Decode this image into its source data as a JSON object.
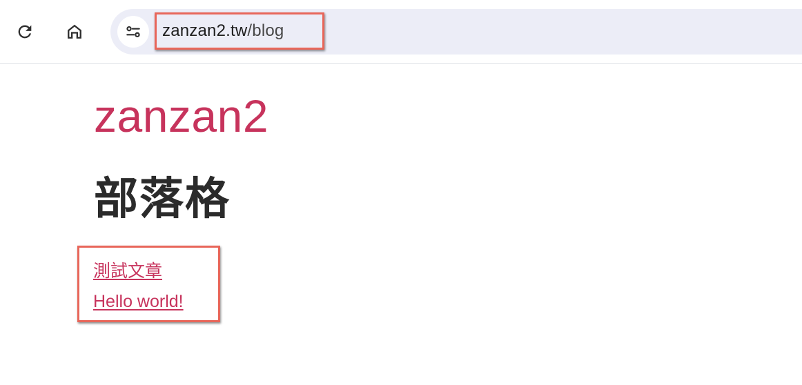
{
  "browser": {
    "url": {
      "host": "zanzan2.tw",
      "path": "/blog"
    },
    "icons": {
      "reload": "reload-icon",
      "home": "home-icon",
      "site_info": "tune-icon"
    }
  },
  "page": {
    "site_title": "zanzan2",
    "heading": "部落格",
    "posts": [
      {
        "title": "測試文章"
      },
      {
        "title": "Hello world!"
      }
    ]
  },
  "colors": {
    "accent": "#c7335c",
    "highlight_box": "#e8665a",
    "omnibox_bg": "#ecedf7"
  }
}
